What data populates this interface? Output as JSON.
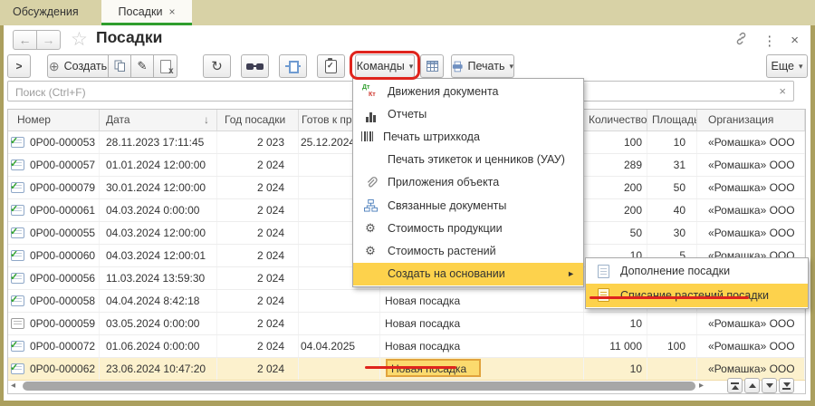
{
  "tabs": [
    {
      "label": "Обсуждения",
      "active": false
    },
    {
      "label": "Посадки",
      "active": true,
      "close": "×"
    }
  ],
  "header": {
    "title": "Посадки"
  },
  "toolbar": {
    "create_label": "Создать",
    "commands_label": "Команды",
    "print_label": "Печать",
    "more_label": "Еще"
  },
  "search": {
    "placeholder": "Поиск (Ctrl+F)"
  },
  "table": {
    "columns": [
      {
        "key": "number",
        "label": "Номер"
      },
      {
        "key": "date",
        "label": "Дата",
        "sorted": "desc"
      },
      {
        "key": "year",
        "label": "Год посадки"
      },
      {
        "key": "ready",
        "label": "Готов к прод"
      },
      {
        "key": "status",
        "label": ""
      },
      {
        "key": "qty",
        "label": "Количество"
      },
      {
        "key": "area",
        "label": "Площадь"
      },
      {
        "key": "org",
        "label": "Организация"
      }
    ],
    "rows": [
      {
        "number": "0Р00-000053",
        "date": "28.11.2023 17:11:45",
        "year": "2 023",
        "ready": "25.12.2024",
        "status": "",
        "qty": "100",
        "area": "10",
        "org": "«Ромашка» ООО",
        "posted": true,
        "selected": false
      },
      {
        "number": "0Р00-000057",
        "date": "01.01.2024 12:00:00",
        "year": "2 024",
        "ready": "",
        "status": "",
        "qty": "289",
        "area": "31",
        "org": "«Ромашка» ООО",
        "posted": true,
        "selected": false
      },
      {
        "number": "0Р00-000079",
        "date": "30.01.2024 12:00:00",
        "year": "2 024",
        "ready": "",
        "status": "",
        "qty": "200",
        "area": "50",
        "org": "«Ромашка» ООО",
        "posted": true,
        "selected": false
      },
      {
        "number": "0Р00-000061",
        "date": "04.03.2024 0:00:00",
        "year": "2 024",
        "ready": "",
        "status": "",
        "qty": "200",
        "area": "40",
        "org": "«Ромашка» ООО",
        "posted": true,
        "selected": false
      },
      {
        "number": "0Р00-000055",
        "date": "04.03.2024 12:00:00",
        "year": "2 024",
        "ready": "",
        "status": "",
        "qty": "50",
        "area": "30",
        "org": "«Ромашка» ООО",
        "posted": true,
        "selected": false
      },
      {
        "number": "0Р00-000060",
        "date": "04.03.2024 12:00:01",
        "year": "2 024",
        "ready": "",
        "status": "",
        "qty": "10",
        "area": "5",
        "org": "«Ромашка» ООО",
        "posted": true,
        "selected": false
      },
      {
        "number": "0Р00-000056",
        "date": "11.03.2024 13:59:30",
        "year": "2 024",
        "ready": "",
        "status": "",
        "qty": "",
        "area": "",
        "org": "",
        "posted": true,
        "selected": false
      },
      {
        "number": "0Р00-000058",
        "date": "04.04.2024 8:42:18",
        "year": "2 024",
        "ready": "",
        "status": "Новая посадка",
        "qty": "",
        "area": "",
        "org": "",
        "posted": true,
        "selected": false
      },
      {
        "number": "0Р00-000059",
        "date": "03.05.2024 0:00:00",
        "year": "2 024",
        "ready": "",
        "status": "Новая посадка",
        "qty": "10",
        "area": "",
        "org": "«Ромашка» ООО",
        "posted": false,
        "selected": false
      },
      {
        "number": "0Р00-000072",
        "date": "01.06.2024 0:00:00",
        "year": "2 024",
        "ready": "04.04.2025",
        "status": "Новая посадка",
        "qty": "11 000",
        "area": "100",
        "org": "«Ромашка» ООО",
        "posted": true,
        "selected": false
      },
      {
        "number": "0Р00-000062",
        "date": "23.06.2024 10:47:20",
        "year": "2 024",
        "ready": "",
        "status": "Новая посадка",
        "qty": "10",
        "area": "",
        "org": "«Ромашка» ООО",
        "posted": true,
        "selected": true
      }
    ]
  },
  "menu": {
    "items": [
      {
        "icon": "dtkt",
        "label": "Движения документа"
      },
      {
        "icon": "report",
        "label": "Отчеты"
      },
      {
        "icon": "barcode",
        "label": "Печать штрихкода"
      },
      {
        "icon": "none",
        "label": "Печать этикеток и ценников (УАУ)"
      },
      {
        "icon": "paperclip",
        "label": "Приложения объекта"
      },
      {
        "icon": "related",
        "label": "Связанные документы"
      },
      {
        "icon": "cost",
        "label": "Стоимость продукции"
      },
      {
        "icon": "cost",
        "label": "Стоимость растений"
      },
      {
        "icon": "none",
        "label": "Создать на основании",
        "submenu": true,
        "highlighted": true
      }
    ]
  },
  "submenu": {
    "items": [
      {
        "icon": "doc",
        "label": "Дополнение посадки",
        "highlighted": false
      },
      {
        "icon": "doc-gold",
        "label": "Списание растений посадки",
        "highlighted": true
      }
    ]
  },
  "icons": {
    "back": "←",
    "forward": "→",
    "star": "☆",
    "kebab": "⋮",
    "close": "×",
    "chevron": ">",
    "plus": "⊕",
    "refresh": "↻",
    "caret": "▾",
    "sort-desc": "↓",
    "submenu-arrow": "►",
    "clear": "×",
    "tab-close": "×",
    "pencil": "✎",
    "check": "✓",
    "gear": "⚙",
    "scroll-left": "◂",
    "scroll-right": "▸",
    "del-x": "x"
  },
  "colors": {
    "olive": "#ab9f5e",
    "tab-green": "#2f9e2d",
    "menu-hl": "#fdd24c",
    "sel-bg": "#fcf1cd",
    "badge-bg": "#fbda6e",
    "badge-border": "#e1a33c",
    "ann-red": "#df241d"
  }
}
